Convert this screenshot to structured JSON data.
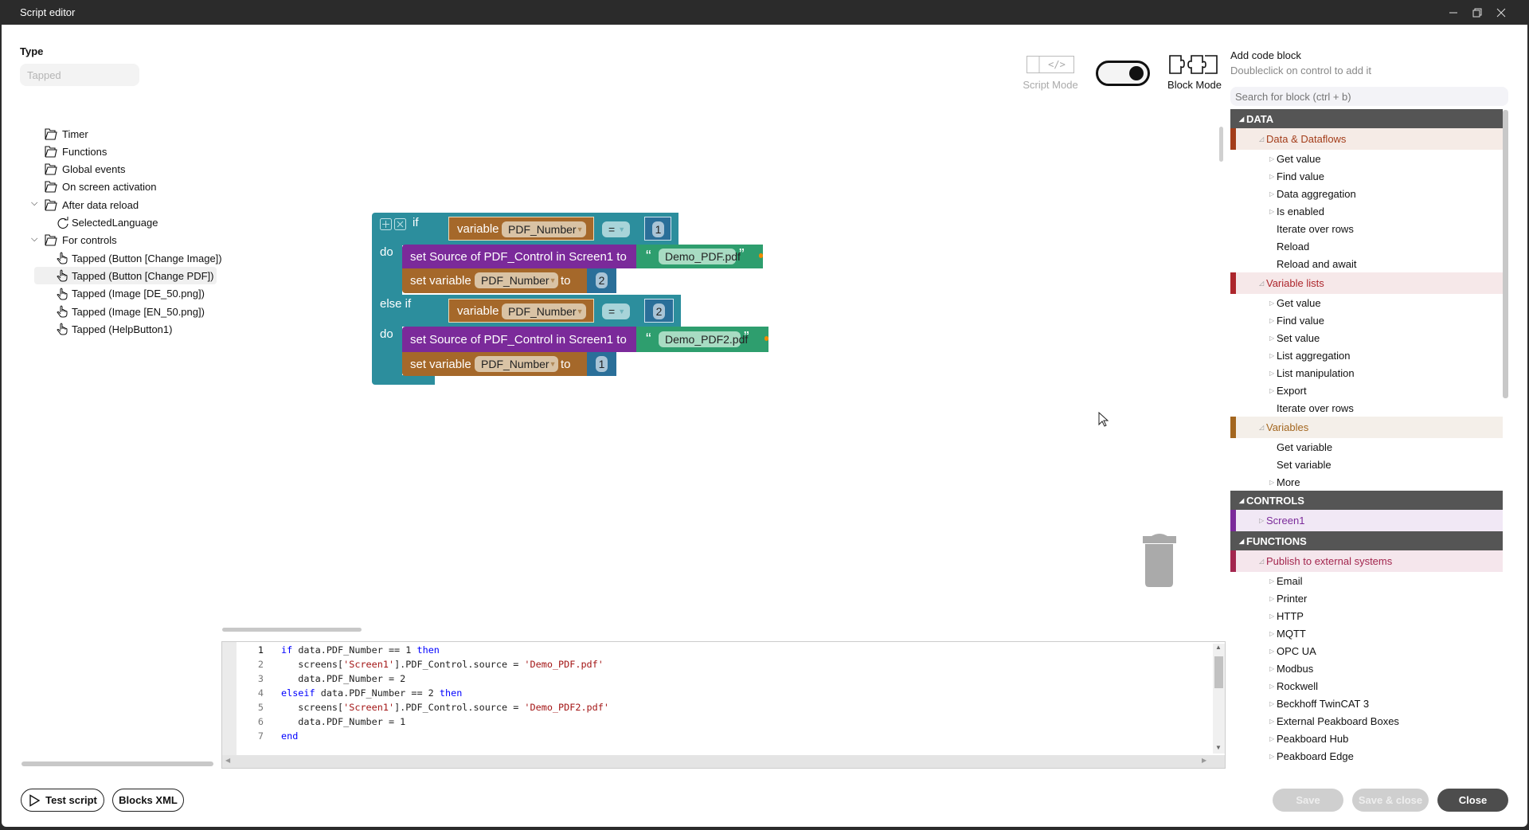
{
  "window": {
    "title": "Script editor"
  },
  "type": {
    "label": "Type",
    "value": "Tapped"
  },
  "tree": [
    {
      "label": "Timer",
      "icon": "folder-icon",
      "level": 0
    },
    {
      "label": "Functions",
      "icon": "folder-icon",
      "level": 0
    },
    {
      "label": "Global events",
      "icon": "folder-icon",
      "level": 0
    },
    {
      "label": "On screen activation",
      "icon": "folder-icon",
      "level": 0
    },
    {
      "label": "After data reload",
      "icon": "folder-icon",
      "level": 0,
      "expanded": true
    },
    {
      "label": "SelectedLanguage",
      "icon": "refresh-icon",
      "level": 1
    },
    {
      "label": "For controls",
      "icon": "folder-icon",
      "level": 0,
      "expanded": true
    },
    {
      "label": "Tapped (Button [Change Image])",
      "icon": "hand-pointer-icon",
      "level": 1
    },
    {
      "label": "Tapped (Button [Change PDF])",
      "icon": "hand-pointer-icon",
      "level": 1,
      "selected": true
    },
    {
      "label": "Tapped (Image [DE_50.png])",
      "icon": "hand-pointer-icon",
      "level": 1
    },
    {
      "label": "Tapped (Image [EN_50.png])",
      "icon": "hand-pointer-icon",
      "level": 1
    },
    {
      "label": "Tapped (HelpButton1)",
      "icon": "hand-pointer-icon",
      "level": 1
    }
  ],
  "blocks": {
    "if": "if",
    "do": "do",
    "else_if": "else if",
    "variable": "variable",
    "var_name": "PDF_Number",
    "eq": "=",
    "cond1_value": "1",
    "cond2_value": "2",
    "set_source": "set Source of PDF_Control in Screen1 to",
    "file1": "Demo_PDF.pdf",
    "file2": "Demo_PDF2.pdf",
    "set_variable": "set variable",
    "to": "to",
    "set1_value": "2",
    "set2_value": "1",
    "open_quote": "“",
    "close_quote": "”"
  },
  "mode": {
    "script_label": "Script Mode",
    "block_label": "Block Mode",
    "block_mode_on": true
  },
  "palette": {
    "title": "Add code block",
    "subtitle": "Doubleclick on control to add it",
    "search_placeholder": "Search for block (ctrl + b)",
    "rows": [
      {
        "kind": "head",
        "label": "DATA"
      },
      {
        "kind": "cat",
        "label": "Data & Dataflows",
        "color": "#a33d1a",
        "bg": "#f5ebe6"
      },
      {
        "kind": "item",
        "label": "Get value",
        "arrow": true
      },
      {
        "kind": "item",
        "label": "Find value",
        "arrow": true
      },
      {
        "kind": "item",
        "label": "Data aggregation",
        "arrow": true
      },
      {
        "kind": "item",
        "label": "Is enabled",
        "arrow": true
      },
      {
        "kind": "item",
        "label": "Iterate over rows",
        "arrow": false
      },
      {
        "kind": "item",
        "label": "Reload",
        "arrow": false
      },
      {
        "kind": "item",
        "label": "Reload and await",
        "arrow": false
      },
      {
        "kind": "cat",
        "label": "Variable lists",
        "color": "#ad262c",
        "bg": "#f6e8e9"
      },
      {
        "kind": "item",
        "label": "Get value",
        "arrow": true
      },
      {
        "kind": "item",
        "label": "Find value",
        "arrow": true
      },
      {
        "kind": "item",
        "label": "Set value",
        "arrow": true
      },
      {
        "kind": "item",
        "label": "List aggregation",
        "arrow": true
      },
      {
        "kind": "item",
        "label": "List manipulation",
        "arrow": true
      },
      {
        "kind": "item",
        "label": "Export",
        "arrow": true
      },
      {
        "kind": "item",
        "label": "Iterate over rows",
        "arrow": false
      },
      {
        "kind": "cat",
        "label": "Variables",
        "color": "#a3661f",
        "bg": "#f4efe9"
      },
      {
        "kind": "item",
        "label": "Get variable",
        "arrow": false
      },
      {
        "kind": "item",
        "label": "Set variable",
        "arrow": false
      },
      {
        "kind": "item",
        "label": "More",
        "arrow": true
      },
      {
        "kind": "head",
        "label": "CONTROLS"
      },
      {
        "kind": "cat",
        "label": "Screen1",
        "color": "#7b2a9a",
        "bg": "#f1e8f5",
        "arrow": true
      },
      {
        "kind": "head",
        "label": "FUNCTIONS"
      },
      {
        "kind": "cat",
        "label": "Publish to external systems",
        "color": "#a3264e",
        "bg": "#f5e6ec"
      },
      {
        "kind": "item",
        "label": "Email",
        "arrow": true
      },
      {
        "kind": "item",
        "label": "Printer",
        "arrow": true
      },
      {
        "kind": "item",
        "label": "HTTP",
        "arrow": true
      },
      {
        "kind": "item",
        "label": "MQTT",
        "arrow": true
      },
      {
        "kind": "item",
        "label": "OPC UA",
        "arrow": true
      },
      {
        "kind": "item",
        "label": "Modbus",
        "arrow": true
      },
      {
        "kind": "item",
        "label": "Rockwell",
        "arrow": true
      },
      {
        "kind": "item",
        "label": "Beckhoff TwinCAT 3",
        "arrow": true
      },
      {
        "kind": "item",
        "label": "External Peakboard Boxes",
        "arrow": true
      },
      {
        "kind": "item",
        "label": "Peakboard Hub",
        "arrow": true
      },
      {
        "kind": "item",
        "label": "Peakboard Edge",
        "arrow": true
      }
    ]
  },
  "code": {
    "colors": {
      "kw": "#0000ff",
      "str": "#a31515",
      "plain": "#222222"
    },
    "lines": [
      [
        [
          "kw",
          "if"
        ],
        [
          "plain",
          " data.PDF_Number == 1 "
        ],
        [
          "kw",
          "then"
        ]
      ],
      [
        [
          "plain",
          "   screens["
        ],
        [
          "str",
          "'Screen1'"
        ],
        [
          "plain",
          "].PDF_Control.source = "
        ],
        [
          "str",
          "'Demo_PDF.pdf'"
        ]
      ],
      [
        [
          "plain",
          "   data.PDF_Number = 2"
        ]
      ],
      [
        [
          "kw",
          "elseif"
        ],
        [
          "plain",
          " data.PDF_Number == 2 "
        ],
        [
          "kw",
          "then"
        ]
      ],
      [
        [
          "plain",
          "   screens["
        ],
        [
          "str",
          "'Screen1'"
        ],
        [
          "plain",
          "].PDF_Control.source = "
        ],
        [
          "str",
          "'Demo_PDF2.pdf'"
        ]
      ],
      [
        [
          "plain",
          "   data.PDF_Number = 1"
        ]
      ],
      [
        [
          "kw",
          "end"
        ]
      ]
    ]
  },
  "buttons": {
    "test": "Test script",
    "xml": "Blocks XML",
    "save": "Save",
    "save_close": "Save & close",
    "close": "Close"
  }
}
